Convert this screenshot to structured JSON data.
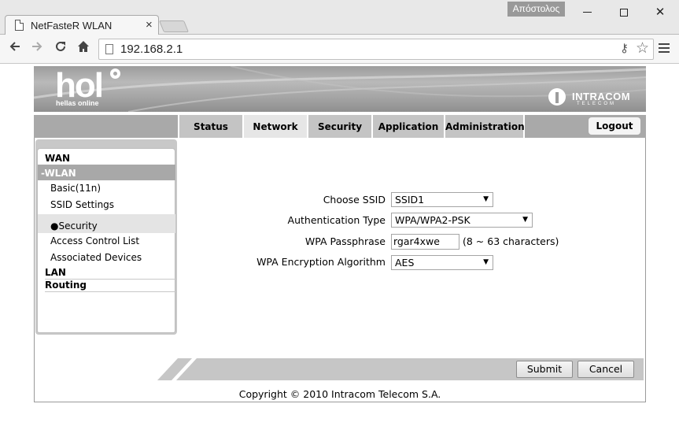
{
  "browser": {
    "tab_title": "NetFasteR WLAN",
    "tab_close": "×",
    "profile_name": "Απόστολος",
    "url": "192.168.2.1",
    "win_close": "✕"
  },
  "banner": {
    "logo_text": "hol",
    "logo_subtext": "hellas online",
    "partner_name": "INTRACOM",
    "partner_subtext": "TELECOM"
  },
  "menu": {
    "tabs": [
      {
        "label": "Status"
      },
      {
        "label": "Network"
      },
      {
        "label": "Security"
      },
      {
        "label": "Application"
      },
      {
        "label": "Administration"
      }
    ],
    "active_tab": "Network",
    "logout_label": "Logout"
  },
  "sidebar": {
    "wan": "WAN",
    "wlan": "-WLAN",
    "basic": "Basic(11n)",
    "ssid_settings": "SSID Settings",
    "security": "Security",
    "access_control": "Access Control List",
    "associated_devices": "Associated Devices",
    "lan": "LAN",
    "routing": "Routing"
  },
  "form": {
    "ssid_label": "Choose SSID",
    "ssid_value": "SSID1",
    "auth_label": "Authentication Type",
    "auth_value": "WPA/WPA2-PSK",
    "pass_label": "WPA Passphrase",
    "pass_value": "rgar4xwe",
    "pass_hint": "(8 ~ 63 characters)",
    "enc_label": "WPA Encryption Algorithm",
    "enc_value": "AES"
  },
  "buttons": {
    "submit": "Submit",
    "cancel": "Cancel"
  },
  "footer": {
    "copyright": "Copyright © 2010 Intracom Telecom S.A."
  }
}
